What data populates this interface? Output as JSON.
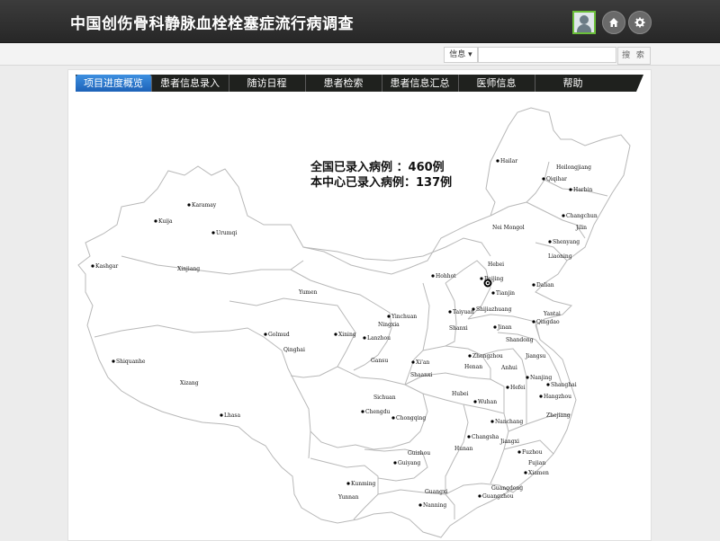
{
  "header": {
    "title": "中国创伤骨科静脉血栓栓塞症流行病调查"
  },
  "toolbar": {
    "info_dropdown": "信息",
    "search_placeholder": "",
    "search_button": "搜 索"
  },
  "nav": {
    "tabs": [
      {
        "label": "项目进度概览",
        "active": true
      },
      {
        "label": "患者信息录入"
      },
      {
        "label": "随访日程"
      },
      {
        "label": "患者检索"
      },
      {
        "label": "患者信息汇总"
      },
      {
        "label": "医师信息"
      },
      {
        "label": "帮助"
      }
    ]
  },
  "stats": {
    "national": "全国已录入病例 ：460例",
    "center": "本中心已录入病例：137例"
  },
  "map": {
    "labels": [
      {
        "text": "Hailar",
        "dot": true
      },
      {
        "text": "Heilongjiang",
        "dot": false
      },
      {
        "text": "Qiqihar",
        "dot": true
      },
      {
        "text": "Harbin",
        "dot": true
      },
      {
        "text": "Changchun",
        "dot": true
      },
      {
        "text": "Jilin",
        "dot": false
      },
      {
        "text": "Nei Mongol",
        "dot": false
      },
      {
        "text": "Shenyang",
        "dot": true
      },
      {
        "text": "Liaoning",
        "dot": false
      },
      {
        "text": "Hebei",
        "dot": false
      },
      {
        "text": "Beijing",
        "dot": true
      },
      {
        "text": "Tianjin",
        "dot": true
      },
      {
        "text": "Dalian",
        "dot": true
      },
      {
        "text": "Hohhot",
        "dot": true
      },
      {
        "text": "Karamay",
        "dot": true
      },
      {
        "text": "Kuija",
        "dot": true
      },
      {
        "text": "Urumqi",
        "dot": true
      },
      {
        "text": "Kashgar",
        "dot": true
      },
      {
        "text": "Xinjiang",
        "dot": false
      },
      {
        "text": "Yumen",
        "dot": false
      },
      {
        "text": "Yinchuan",
        "dot": true
      },
      {
        "text": "Ningxia",
        "dot": false
      },
      {
        "text": "Taiyuan",
        "dot": true
      },
      {
        "text": "Shijiazhuang",
        "dot": true
      },
      {
        "text": "Yantai",
        "dot": false
      },
      {
        "text": "Qingdao",
        "dot": true
      },
      {
        "text": "Shanxi",
        "dot": false
      },
      {
        "text": "Jinan",
        "dot": true
      },
      {
        "text": "Shandong",
        "dot": false
      },
      {
        "text": "Golmud",
        "dot": true
      },
      {
        "text": "Xining",
        "dot": true
      },
      {
        "text": "Lanzhou",
        "dot": true
      },
      {
        "text": "Qinghai",
        "dot": false
      },
      {
        "text": "Gansu",
        "dot": false
      },
      {
        "text": "Xi'an",
        "dot": true
      },
      {
        "text": "Zhengzhou",
        "dot": true
      },
      {
        "text": "Jiangsu",
        "dot": false
      },
      {
        "text": "Henan",
        "dot": false
      },
      {
        "text": "Anhui",
        "dot": false
      },
      {
        "text": "Nanjing",
        "dot": true
      },
      {
        "text": "Hefei",
        "dot": true
      },
      {
        "text": "Shanghai",
        "dot": true
      },
      {
        "text": "Hangzhou",
        "dot": true
      },
      {
        "text": "Shaanxi",
        "dot": false
      },
      {
        "text": "Shiquanhe",
        "dot": true
      },
      {
        "text": "Xizang",
        "dot": false
      },
      {
        "text": "Lhasa",
        "dot": true
      },
      {
        "text": "Sichuan",
        "dot": false
      },
      {
        "text": "Hubei",
        "dot": false
      },
      {
        "text": "Wuhan",
        "dot": true
      },
      {
        "text": "Zhejiang",
        "dot": false
      },
      {
        "text": "Chengdu",
        "dot": true
      },
      {
        "text": "Chongqing",
        "dot": true
      },
      {
        "text": "Nanchang",
        "dot": true
      },
      {
        "text": "Changsha",
        "dot": true
      },
      {
        "text": "Jiangxi",
        "dot": false
      },
      {
        "text": "Hunan",
        "dot": false
      },
      {
        "text": "Fuzhou",
        "dot": true
      },
      {
        "text": "Guizhou",
        "dot": false
      },
      {
        "text": "Guiyang",
        "dot": true
      },
      {
        "text": "Fujian",
        "dot": false
      },
      {
        "text": "Xiamen",
        "dot": true
      },
      {
        "text": "Kunming",
        "dot": true
      },
      {
        "text": "Yunnan",
        "dot": false
      },
      {
        "text": "Guangdong",
        "dot": false
      },
      {
        "text": "Guangzhou",
        "dot": true
      },
      {
        "text": "Guangxi",
        "dot": false
      },
      {
        "text": "Nanning",
        "dot": true
      }
    ]
  }
}
